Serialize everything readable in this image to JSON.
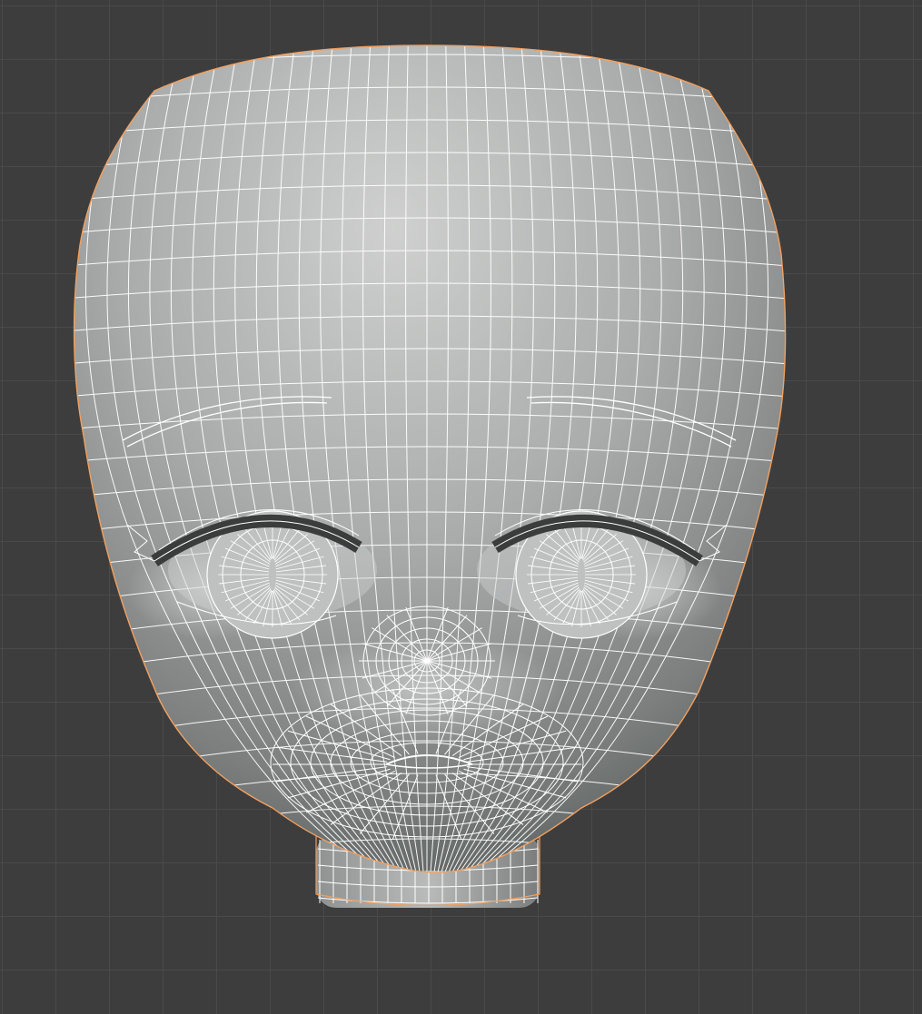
{
  "viewport": {
    "background": "#3d3d3d",
    "grid_color": "#4a4a4a",
    "selection_outline_color": "#f0a060",
    "wire_color": "#ffffff",
    "object": "head-mesh",
    "mode": "edit",
    "shading": "solid-wireframe-overlay"
  }
}
